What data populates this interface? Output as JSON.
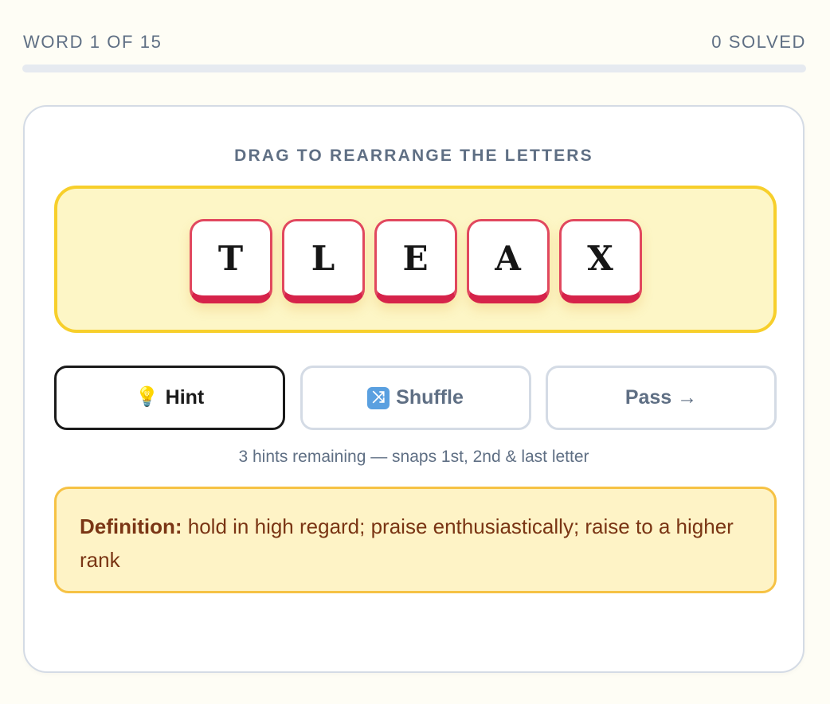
{
  "progress": {
    "word_label": "WORD 1 OF 15",
    "solved_label": "0 SOLVED",
    "fraction": 0
  },
  "instruction": "DRAG TO REARRANGE THE LETTERS",
  "tiles": [
    "T",
    "L",
    "E",
    "A",
    "X"
  ],
  "buttons": {
    "hint_label": "Hint",
    "shuffle_label": "Shuffle",
    "pass_label": "Pass →"
  },
  "hint_note": "3 hints remaining — snaps 1st, 2nd & last letter",
  "definition": {
    "label": "Definition:",
    "text": "hold in high regard; praise enthusiastically; raise to a higher rank"
  },
  "colors": {
    "tile_border": "#e1485f",
    "tray_border": "#f7cf2b",
    "definition_bg": "#fef3c6"
  },
  "icons": {
    "hint": "lightbulb-icon",
    "shuffle": "shuffle-icon"
  }
}
